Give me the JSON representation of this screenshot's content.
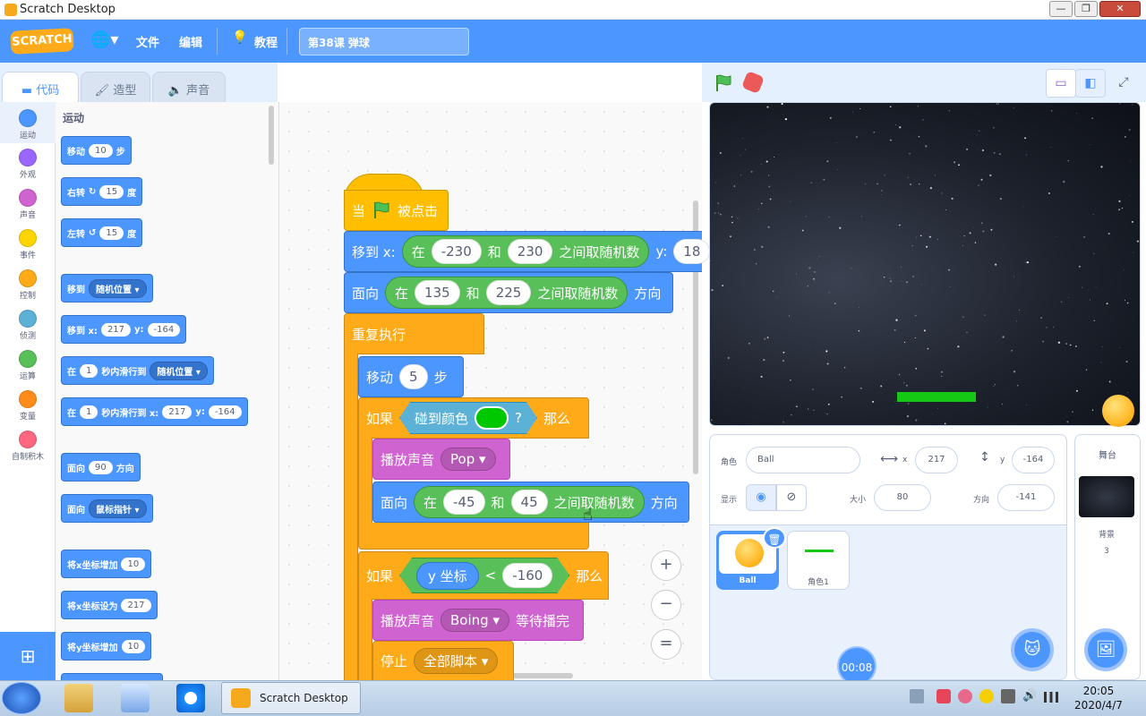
{
  "window": {
    "title": "Scratch Desktop",
    "min": "—",
    "max": "❐",
    "close": "✕"
  },
  "menubar": {
    "logo": "SCRATCH",
    "globe": "🌐▾",
    "file": "文件",
    "edit": "编辑",
    "tutorials": "教程",
    "tutorials_icon": "💡",
    "project_title": "第38课 弹球"
  },
  "tabs": {
    "code": "代码",
    "costumes": "造型",
    "sounds": "声音"
  },
  "categories": [
    {
      "label": "运动",
      "color": "#4c97ff"
    },
    {
      "label": "外观",
      "color": "#9966ff"
    },
    {
      "label": "声音",
      "color": "#cf63cf"
    },
    {
      "label": "事件",
      "color": "#ffd500"
    },
    {
      "label": "控制",
      "color": "#ffab19"
    },
    {
      "label": "侦测",
      "color": "#5cb1d6"
    },
    {
      "label": "运算",
      "color": "#59c059"
    },
    {
      "label": "变量",
      "color": "#ff8c1a"
    },
    {
      "label": "自制积木",
      "color": "#ff6680"
    }
  ],
  "palette": {
    "heading": "运动",
    "move": {
      "a": "移动",
      "n": "10",
      "b": "步"
    },
    "turn_right": {
      "a": "右转",
      "n": "15",
      "b": "度"
    },
    "turn_left": {
      "a": "左转",
      "n": "15",
      "b": "度"
    },
    "goto": {
      "a": "移到",
      "dd": "随机位置"
    },
    "goto_xy": {
      "a": "移到 x:",
      "x": "217",
      "b": "y:",
      "y": "-164"
    },
    "glide": {
      "a": "在",
      "n": "1",
      "b": "秒内滑行到",
      "dd": "随机位置"
    },
    "glide_xy": {
      "a": "在",
      "n": "1",
      "b": "秒内滑行到 x:",
      "x": "217",
      "c": "y:",
      "y": "-164"
    },
    "point_dir": {
      "a": "面向",
      "n": "90",
      "b": "方向"
    },
    "point_towards": {
      "a": "面向",
      "dd": "鼠标指针"
    },
    "change_x": {
      "a": "将x坐标增加",
      "n": "10"
    },
    "set_x": {
      "a": "将x坐标设为",
      "n": "217"
    },
    "change_y": {
      "a": "将y坐标增加",
      "n": "10"
    }
  },
  "script": {
    "hat": {
      "a": "当",
      "b": "被点击"
    },
    "goto": {
      "a": "移到 x:",
      "in": "在",
      "lo": "-230",
      "and": "和",
      "hi": "230",
      "rand": "之间取随机数",
      "y": "y:",
      "y_val": "18"
    },
    "point": {
      "a": "面向",
      "in": "在",
      "lo": "135",
      "and": "和",
      "hi": "225",
      "rand": "之间取随机数",
      "dir": "方向"
    },
    "forever": "重复执行",
    "move": {
      "a": "移动",
      "n": "5",
      "b": "步"
    },
    "if1": {
      "a": "如果",
      "touch": "碰到颜色",
      "q": "?",
      "then": "那么",
      "touch_color": "#00c800"
    },
    "play": {
      "a": "播放声音",
      "dd": "Pop"
    },
    "point2": {
      "a": "面向",
      "in": "在",
      "lo": "-45",
      "and": "和",
      "hi": "45",
      "rand": "之间取随机数",
      "dir": "方向"
    },
    "if2": {
      "a": "如果",
      "rep": "y 坐标",
      "lt": "<",
      "n": "-160",
      "then": "那么"
    },
    "play2": {
      "a": "播放声音",
      "dd": "Boing",
      "b": "等待播完"
    },
    "stop": {
      "a": "停止",
      "dd": "全部脚本"
    }
  },
  "zoom": {
    "in": "+",
    "out": "−",
    "reset": "="
  },
  "stage_controls": {
    "small": "▭",
    "normal": "◧",
    "full": "⤢"
  },
  "sprite_info": {
    "sprite_label": "角色",
    "sprite_name": "Ball",
    "x_label": "x",
    "x": "217",
    "y_label": "y",
    "y": "-164",
    "show_label": "显示",
    "size_label": "大小",
    "size": "80",
    "dir_label": "方向",
    "dir": "-141"
  },
  "sprites": [
    {
      "name": "Ball",
      "selected": true
    },
    {
      "name": "角色1",
      "selected": false
    }
  ],
  "stage_pane": {
    "title": "舞台",
    "backdrops_label": "背景",
    "backdrops_count": "3"
  },
  "timer": "00:08",
  "taskbar": {
    "app": "Scratch Desktop",
    "time": "20:05",
    "date": "2020/4/7"
  }
}
